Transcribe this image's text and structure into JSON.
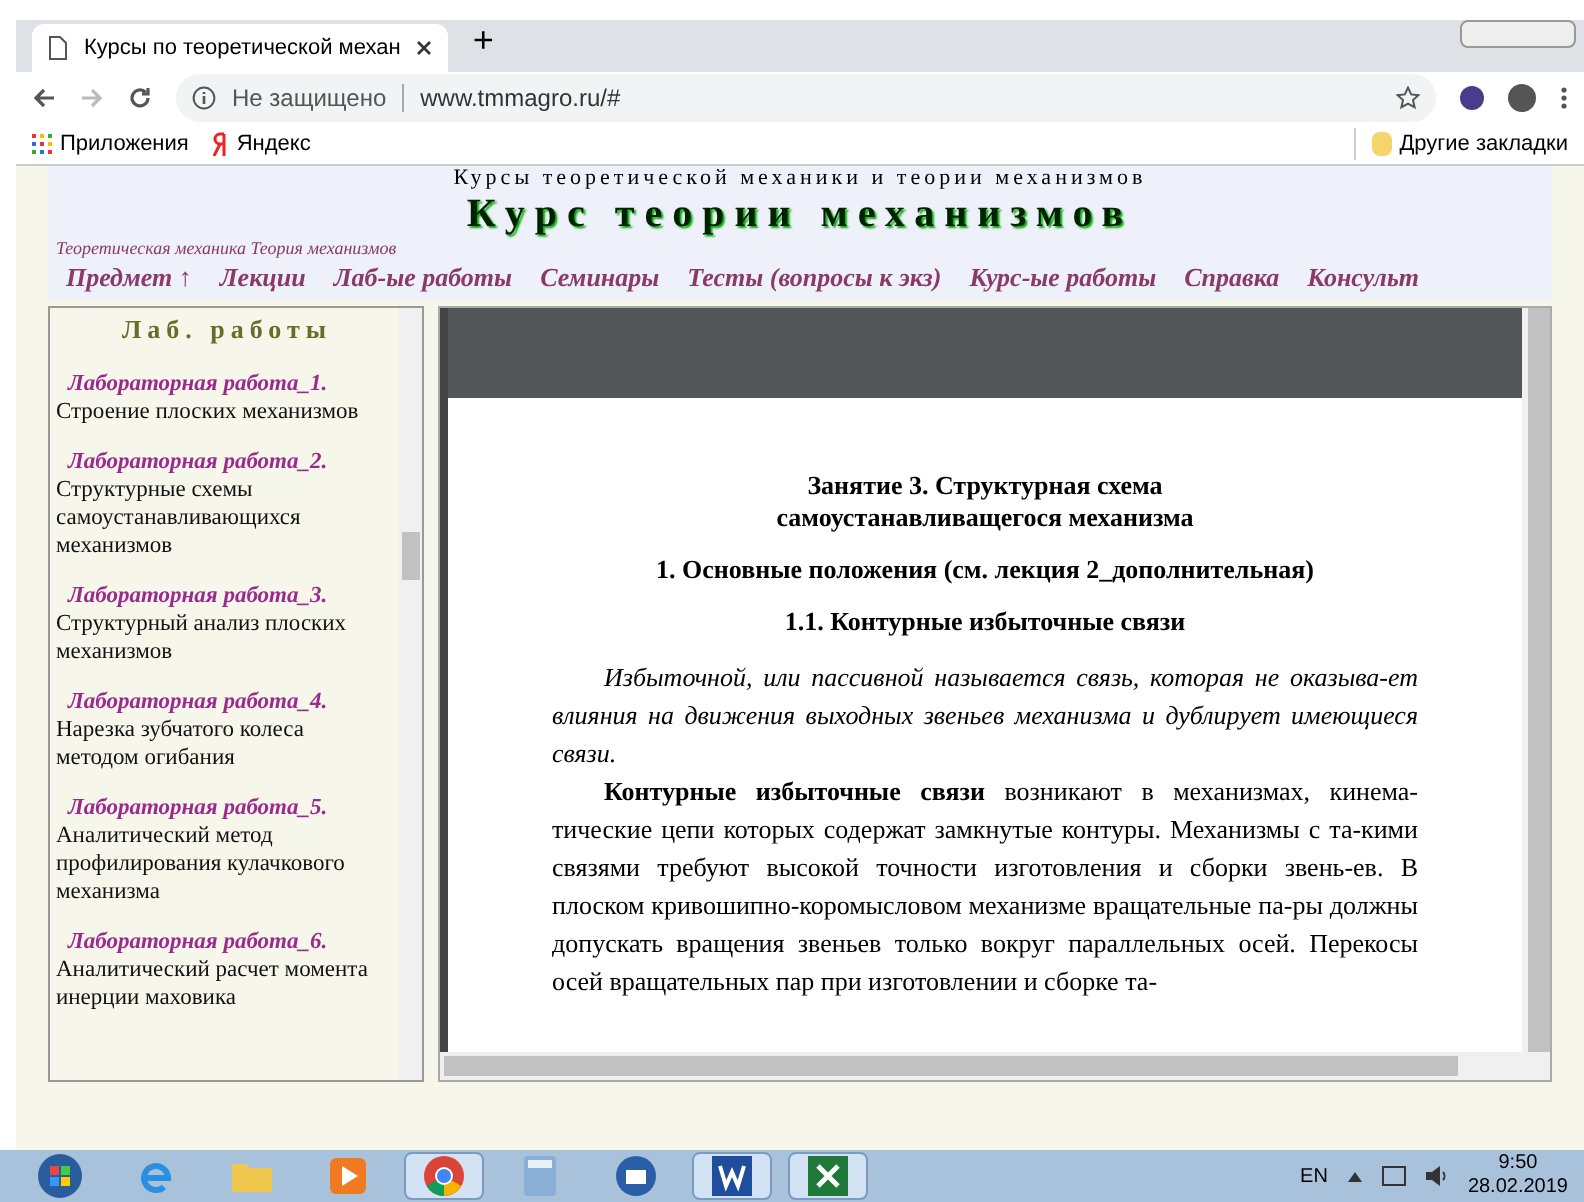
{
  "browser": {
    "tab_title": "Курсы по теоретической механ",
    "new_tab": "+",
    "security": "Не защищено",
    "url": "www.tmmagro.ru/#",
    "bookmarks": [
      {
        "kind": "apps",
        "label": "Приложения"
      },
      {
        "kind": "yandex",
        "label": "Яндекс"
      }
    ],
    "other_bookmarks": "Другие закладки"
  },
  "site": {
    "subtitle": "Курсы теоретической механики и теории механизмов",
    "title": "Курс теории механизмов",
    "breadcrumb": "Теоретическая механика  Теория механизмов",
    "nav": [
      "Предмет ↑",
      "Лекции",
      "Лаб-ые работы",
      "Семинары",
      "Тесты (вопросы к экз)",
      "Курс-ые работы",
      "Справка",
      "Консульт"
    ]
  },
  "sidebar": {
    "heading": "Лаб. работы",
    "items": [
      {
        "title": "Лабораторная работа_1.",
        "text": "Строение плоских механизмов"
      },
      {
        "title": "Лабораторная работа_2.",
        "text": "Структурные схемы самоустанавливающихся механизмов"
      },
      {
        "title": "Лабораторная работа_3.",
        "text": "Структурный анализ плоских механизмов"
      },
      {
        "title": "Лабораторная работа_4.",
        "text": "Нарезка зубчатого колеса методом огибания"
      },
      {
        "title": "Лабораторная работа_5.",
        "text": "Аналитический метод профилирования кулачкового механизма"
      },
      {
        "title": "Лабораторная работа_6.",
        "text": "Аналитический расчет момента инерции маховика"
      }
    ]
  },
  "document": {
    "blocks": [
      {
        "kind": "heading",
        "text": "Занятие 3. Структурная схема\nсамоустанавливащегося механизма"
      },
      {
        "kind": "heading",
        "text": "1. Основные положения (см. лекция 2_дополнительная)"
      },
      {
        "kind": "heading",
        "text": "1.1. Контурные избыточные связи"
      },
      {
        "kind": "italic",
        "text": "Избыточной, или пассивной называется связь, которая не оказыва-ет влияния на движения выходных звеньев механизма и дублирует имеющиеся связи."
      },
      {
        "kind": "paragraph",
        "text": "**Контурные избыточные связи** возникают в механизмах, кинема-тические цепи которых содержат замкнутые контуры. Механизмы с та-кими связями требуют высокой точности изготовления и сборки звень-ев. В плоском кривошипно-коромысловом механизме вращательные па-ры должны допускать вращения звеньев только вокруг параллельных осей. Перекосы осей вращательных пар при изготовлении и сборке та-"
      }
    ]
  },
  "taskbar": {
    "apps": [
      {
        "kind": "start",
        "selected": false
      },
      {
        "kind": "ie",
        "selected": false
      },
      {
        "kind": "folder",
        "selected": false
      },
      {
        "kind": "media",
        "selected": false
      },
      {
        "kind": "chrome",
        "selected": true
      },
      {
        "kind": "calculator",
        "selected": false
      },
      {
        "kind": "mail",
        "selected": false
      },
      {
        "kind": "word",
        "selected": true
      },
      {
        "kind": "excel",
        "selected": true
      }
    ],
    "language": "EN",
    "time": "9:50",
    "date": "28.02.2019"
  }
}
